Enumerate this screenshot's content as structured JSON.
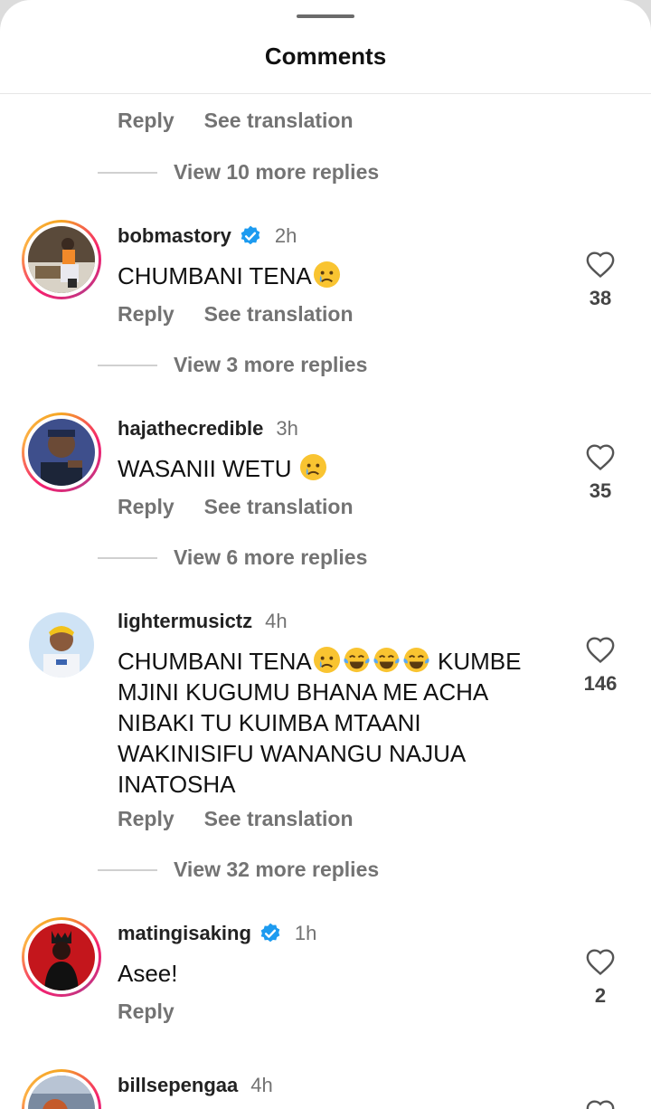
{
  "sheet": {
    "title": "Comments"
  },
  "labels": {
    "reply": "Reply",
    "see_translation": "See translation"
  },
  "top": {
    "view_more": "View 10 more replies"
  },
  "comments": [
    {
      "username": "bobmastory",
      "verified": true,
      "time": "2h",
      "text": "CHUMBANI TENA",
      "emojis": [
        "crying-face"
      ],
      "likes": "38",
      "view_more": "View 3 more replies",
      "has_translation": true
    },
    {
      "username": "hajathecredible",
      "verified": false,
      "time": "3h",
      "text": "WASANII WETU ",
      "emojis": [
        "crying-face"
      ],
      "likes": "35",
      "view_more": "View 6 more replies",
      "has_translation": true
    },
    {
      "username": "lightermusictz",
      "verified": false,
      "time": "4h",
      "text_line1": "CHUMBANI TENA",
      "emojis": [
        "crying-face",
        "tears-of-joy",
        "tears-of-joy",
        "tears-of-joy"
      ],
      "text_line1_tail": " KUMBE",
      "text_rest": "MJINI KUGUMU BHANA ME ACHA NIBAKI TU KUIMBA MTAANI WAKINISIFU WANANGU NAJUA INATOSHA",
      "likes": "146",
      "view_more": "View 32 more replies",
      "has_translation": true
    },
    {
      "username": "matingisaking",
      "verified": true,
      "time": "1h",
      "text": "Asee!",
      "likes": "2",
      "has_translation": false
    },
    {
      "username": "billsepengaa",
      "verified": false,
      "time": "4h"
    }
  ],
  "colors": {
    "accent_verified": "#1d9bf0",
    "secondary_text": "#737373",
    "ring": "#f5206e"
  }
}
